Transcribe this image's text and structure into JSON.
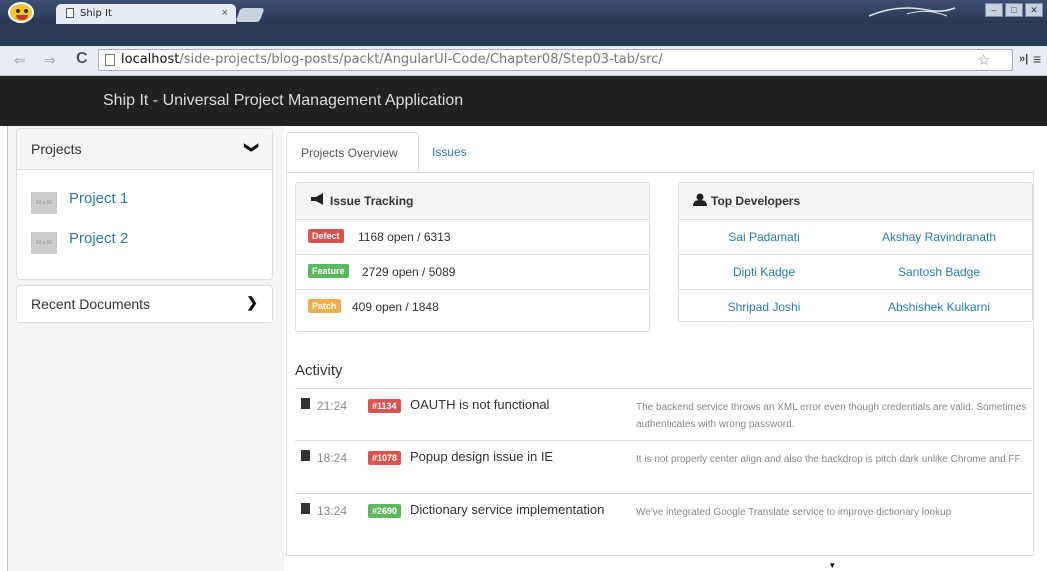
{
  "browser": {
    "tab_title": "Ship It",
    "tab_close": "×",
    "url_host": "localhost",
    "url_path": "/side-projects/blog-posts/packt/AngularUI-Code/Chapter08/Step03-tab/src/",
    "back_icon": "⇐",
    "forward_icon": "⇒",
    "reload_icon": "C",
    "star_icon": "☆",
    "ext_label": "»|",
    "menu_icon": "≡"
  },
  "navbar": {
    "brand": "Ship It - Universal Project Management Application"
  },
  "sidebar": {
    "projects_header": "Projects",
    "projects_chevron": "❯",
    "projects": [
      {
        "name": "Project 1",
        "thumb_text": "90 x 90"
      },
      {
        "name": "Project 2",
        "thumb_text": "90 x 90"
      }
    ],
    "recent_header": "Recent Documents",
    "recent_chevron": "❯"
  },
  "main": {
    "tabs": [
      {
        "label": "Projects Overview"
      },
      {
        "label": "Issues"
      }
    ],
    "issue_tracking": {
      "title": "Issue Tracking",
      "icon": "bullhorn-icon",
      "rows": [
        {
          "badge": "Defect",
          "color": "#d9534f",
          "text": "1168 open / 6313"
        },
        {
          "badge": "Feature",
          "color": "#5cb85c",
          "text": "2729 open / 5089"
        },
        {
          "badge": "Patch",
          "color": "#f0ad4e",
          "text": "409 open / 1848"
        }
      ]
    },
    "top_developers": {
      "title": "Top Developers",
      "icon": "user-icon",
      "rows": [
        [
          "Sai Padamati",
          "Akshay Ravindranath"
        ],
        [
          "Dipti Kadge",
          "Santosh Badge"
        ],
        [
          "Shripad Joshi",
          "Abshishek Kulkarni"
        ]
      ]
    },
    "activity": {
      "title": "Activity",
      "items": [
        {
          "time": "21:24",
          "badge": "#1134",
          "color": "#d9534f",
          "title": "OAUTH is not functional",
          "desc": "The backend service throws an XML error even though credentials are valid. Sometimes authenticates with wrong password."
        },
        {
          "time": "18:24",
          "badge": "#1078",
          "color": "#d9534f",
          "title": "Popup design issue in IE",
          "desc": "It is not properly center align and also the backdrop is pitch dark unlike Chrome and FF."
        },
        {
          "time": "13:24",
          "badge": "#2690",
          "color": "#5cb85c",
          "title": "Dictionary service implementation",
          "desc": "We've integrated Google Translate service to improve dictionary lookup"
        }
      ]
    }
  }
}
